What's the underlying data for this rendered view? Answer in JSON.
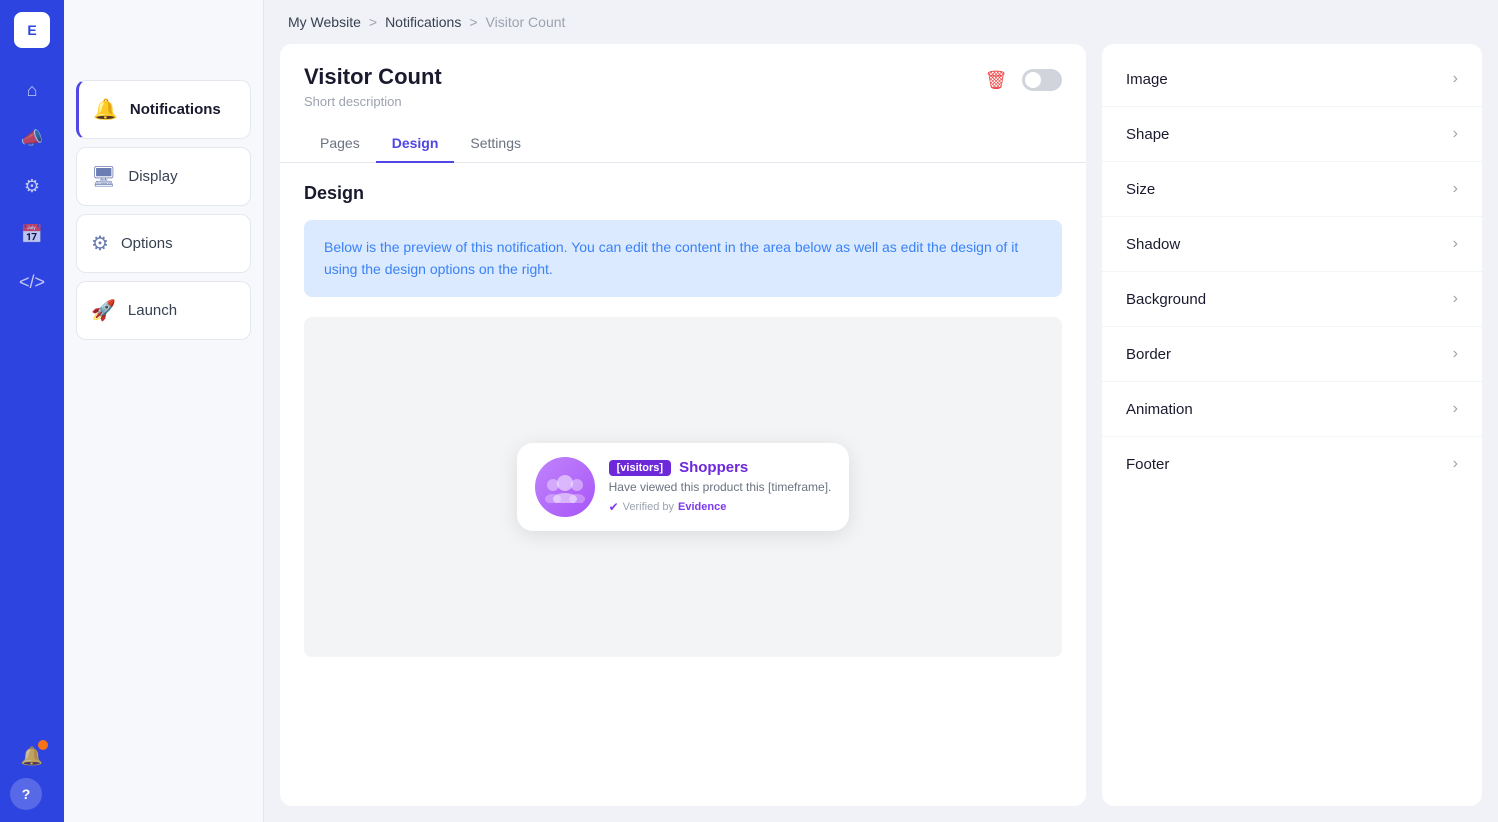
{
  "sidebar": {
    "logo": "E",
    "icons": [
      {
        "name": "home-icon",
        "symbol": "⌂",
        "active": false
      },
      {
        "name": "megaphone-icon",
        "symbol": "📣",
        "active": false
      },
      {
        "name": "settings-icon",
        "symbol": "⚙",
        "active": false
      },
      {
        "name": "calendar-icon",
        "symbol": "📅",
        "active": false
      },
      {
        "name": "code-icon",
        "symbol": "</>",
        "active": false
      }
    ],
    "bottom_icons": [
      {
        "name": "notification-icon",
        "symbol": "🔔",
        "has_dot": true
      },
      {
        "name": "help-icon",
        "symbol": "?",
        "has_dot": false
      }
    ]
  },
  "nav": {
    "items": [
      {
        "name": "notifications-nav",
        "icon": "🔔",
        "label": "Notifications",
        "active": true
      },
      {
        "name": "display-nav",
        "icon": "🖥",
        "label": "Display",
        "active": false
      },
      {
        "name": "options-nav",
        "icon": "⚙",
        "label": "Options",
        "active": false
      },
      {
        "name": "launch-nav",
        "icon": "🚀",
        "label": "Launch",
        "active": false
      }
    ]
  },
  "breadcrumb": {
    "items": [
      "My Website",
      "Notifications",
      "Visitor Count"
    ],
    "separators": [
      ">",
      ">"
    ]
  },
  "main_panel": {
    "title": "Visitor Count",
    "description": "Short description",
    "tabs": [
      {
        "name": "pages-tab",
        "label": "Pages"
      },
      {
        "name": "design-tab",
        "label": "Design",
        "active": true
      },
      {
        "name": "settings-tab",
        "label": "Settings"
      }
    ],
    "section_title": "Design",
    "info_text": "Below is the preview of this notification. You can edit the content in the area below as well as edit the design of it using the design options on the right.",
    "preview": {
      "visitors_badge": "[visitors]",
      "name": "Shoppers",
      "text": "Have viewed this product this [timeframe].",
      "verified_text": "Verified by",
      "evidence_text": "Evidence"
    }
  },
  "right_panel": {
    "items": [
      {
        "name": "image-item",
        "label": "Image"
      },
      {
        "name": "shape-item",
        "label": "Shape"
      },
      {
        "name": "size-item",
        "label": "Size"
      },
      {
        "name": "shadow-item",
        "label": "Shadow"
      },
      {
        "name": "background-item",
        "label": "Background"
      },
      {
        "name": "border-item",
        "label": "Border"
      },
      {
        "name": "animation-item",
        "label": "Animation"
      },
      {
        "name": "footer-item",
        "label": "Footer"
      }
    ]
  }
}
